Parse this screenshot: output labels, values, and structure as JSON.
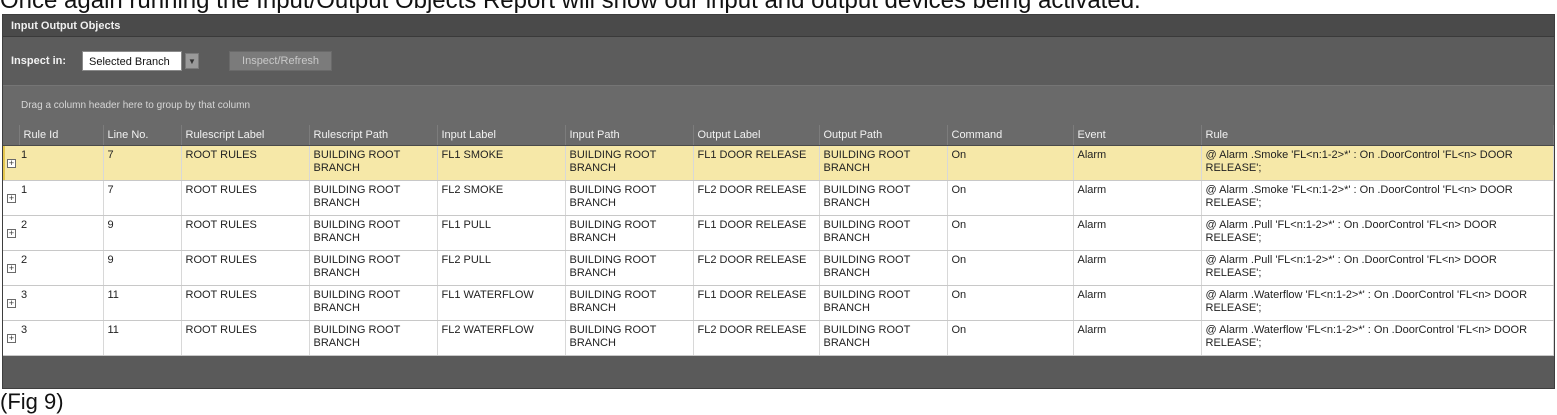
{
  "document": {
    "top_line": "Once again running the Input/Output Objects Report will show our input and output devices being activated:",
    "caption": "(Fig 9)"
  },
  "window": {
    "title": "Input Output Objects"
  },
  "toolbar": {
    "inspect_label": "Inspect in:",
    "inspect_value": "Selected Branch",
    "refresh_label": "Inspect/Refresh"
  },
  "group_bar": {
    "hint": "Drag a column header here to group by that column"
  },
  "grid": {
    "columns": [
      "Rule Id",
      "Line No.",
      "Rulescript Label",
      "Rulescript Path",
      "Input Label",
      "Input Path",
      "Output Label",
      "Output Path",
      "Command",
      "Event",
      "Rule"
    ],
    "rows": [
      {
        "rule_id": "1",
        "line_no": "7",
        "rulescript_label": "ROOT RULES",
        "rulescript_path": "BUILDING ROOT BRANCH",
        "input_label": "FL1 SMOKE",
        "input_path": "BUILDING ROOT BRANCH",
        "output_label": "FL1 DOOR RELEASE",
        "output_path": "BUILDING ROOT BRANCH",
        "command": "On",
        "event": "Alarm",
        "rule": "@ Alarm .Smoke 'FL<n:1-2>*' : On .DoorControl 'FL<n> DOOR RELEASE';",
        "selected": true
      },
      {
        "rule_id": "1",
        "line_no": "7",
        "rulescript_label": "ROOT RULES",
        "rulescript_path": "BUILDING ROOT BRANCH",
        "input_label": "FL2 SMOKE",
        "input_path": "BUILDING ROOT BRANCH",
        "output_label": "FL2 DOOR RELEASE",
        "output_path": "BUILDING ROOT BRANCH",
        "command": "On",
        "event": "Alarm",
        "rule": "@ Alarm .Smoke 'FL<n:1-2>*' : On .DoorControl 'FL<n> DOOR RELEASE';",
        "selected": false
      },
      {
        "rule_id": "2",
        "line_no": "9",
        "rulescript_label": "ROOT RULES",
        "rulescript_path": "BUILDING ROOT BRANCH",
        "input_label": "FL1 PULL",
        "input_path": "BUILDING ROOT BRANCH",
        "output_label": "FL1 DOOR RELEASE",
        "output_path": "BUILDING ROOT BRANCH",
        "command": "On",
        "event": "Alarm",
        "rule": "@ Alarm .Pull 'FL<n:1-2>*' : On .DoorControl 'FL<n> DOOR RELEASE';",
        "selected": false
      },
      {
        "rule_id": "2",
        "line_no": "9",
        "rulescript_label": "ROOT RULES",
        "rulescript_path": "BUILDING ROOT BRANCH",
        "input_label": "FL2 PULL",
        "input_path": "BUILDING ROOT BRANCH",
        "output_label": "FL2 DOOR RELEASE",
        "output_path": "BUILDING ROOT BRANCH",
        "command": "On",
        "event": "Alarm",
        "rule": "@ Alarm .Pull 'FL<n:1-2>*' : On .DoorControl 'FL<n> DOOR RELEASE';",
        "selected": false
      },
      {
        "rule_id": "3",
        "line_no": "11",
        "rulescript_label": "ROOT RULES",
        "rulescript_path": "BUILDING ROOT BRANCH",
        "input_label": "FL1 WATERFLOW",
        "input_path": "BUILDING ROOT BRANCH",
        "output_label": "FL1 DOOR RELEASE",
        "output_path": "BUILDING ROOT BRANCH",
        "command": "On",
        "event": "Alarm",
        "rule": "@ Alarm .Waterflow 'FL<n:1-2>*' : On .DoorControl 'FL<n> DOOR RELEASE';",
        "selected": false
      },
      {
        "rule_id": "3",
        "line_no": "11",
        "rulescript_label": "ROOT RULES",
        "rulescript_path": "BUILDING ROOT BRANCH",
        "input_label": "FL2 WATERFLOW",
        "input_path": "BUILDING ROOT BRANCH",
        "output_label": "FL2 DOOR RELEASE",
        "output_path": "BUILDING ROOT BRANCH",
        "command": "On",
        "event": "Alarm",
        "rule": "@ Alarm .Waterflow 'FL<n:1-2>*' : On .DoorControl 'FL<n> DOOR RELEASE';",
        "selected": false
      }
    ]
  },
  "colors": {
    "selected_row": "#f6e8a8",
    "header_bg": "#6a6a6a",
    "window_bg": "#5a5a5a"
  },
  "icons": {
    "expander": "plus-box-icon",
    "dropdown": "chevron-down-icon"
  }
}
